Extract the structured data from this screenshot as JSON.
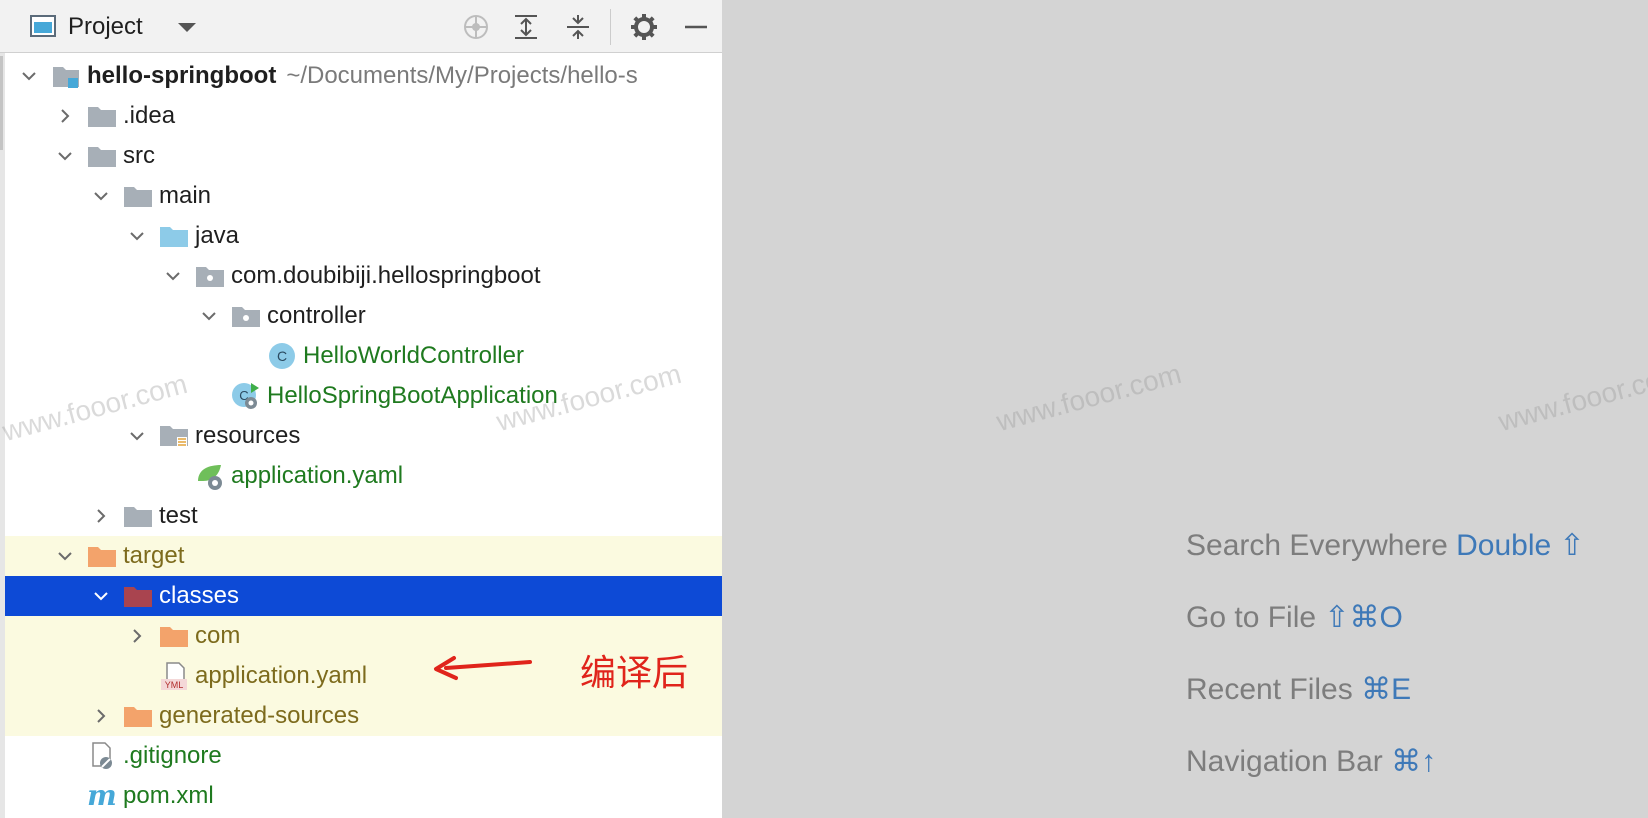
{
  "toolbar": {
    "title": "Project",
    "icons": [
      "project-view-icon",
      "dropdown-caret-icon",
      "locate-icon",
      "expand-all-icon",
      "collapse-all-icon",
      "gear-icon",
      "minimize-icon"
    ]
  },
  "tree": {
    "root": {
      "label": "hello-springboot",
      "path": "~/Documents/My/Projects/hello-s"
    },
    "idea": ".idea",
    "src": "src",
    "main": "main",
    "java": "java",
    "package": "com.doubibiji.hellospringboot",
    "controller": "controller",
    "controller_class": "HelloWorldController",
    "app_class": "HelloSpringBootApplication",
    "resources": "resources",
    "resources_yaml": "application.yaml",
    "test": "test",
    "target": "target",
    "classes": "classes",
    "com": "com",
    "classes_yaml": "application.yaml",
    "generated_sources": "generated-sources",
    "gitignore": ".gitignore",
    "pom": "pom.xml"
  },
  "annotation": {
    "text": "编译后",
    "color": "#e0241b"
  },
  "watermark": "www.fooor.com",
  "hints": [
    {
      "text": "Search Everywhere",
      "key": "Double ⇧"
    },
    {
      "text": "Go to File",
      "key": "⇧⌘O"
    },
    {
      "text": "Recent Files",
      "key": "⌘E"
    },
    {
      "text": "Navigation Bar",
      "key": "⌘↑"
    }
  ],
  "colors": {
    "selection": "#0d4ad6",
    "excluded_bg": "#fbfae0",
    "shortcut": "#3e79b8",
    "source_folder": "#8dcbe8",
    "excluded_folder": "#f3a36b"
  }
}
